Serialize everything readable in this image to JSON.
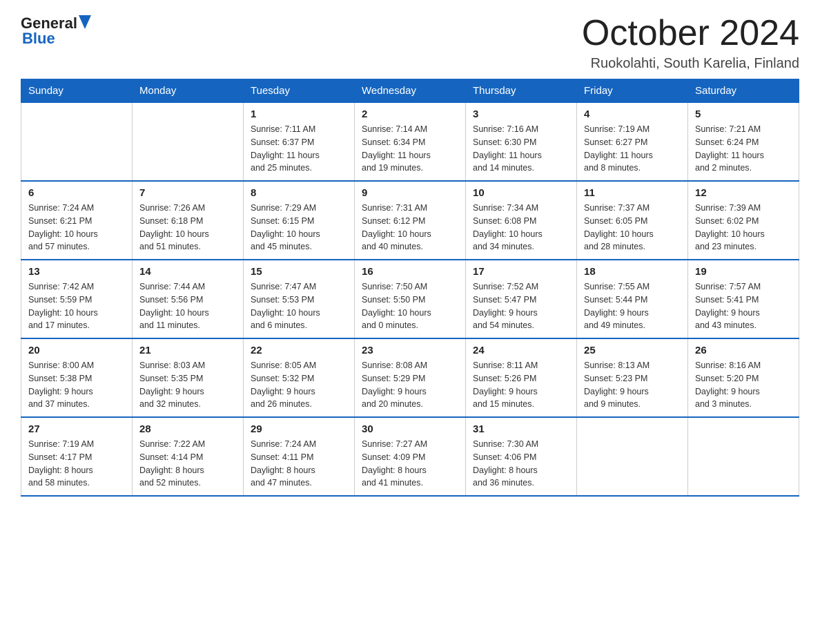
{
  "header": {
    "logo_general": "General",
    "logo_blue": "Blue",
    "title": "October 2024",
    "subtitle": "Ruokolahti, South Karelia, Finland"
  },
  "calendar": {
    "days_of_week": [
      "Sunday",
      "Monday",
      "Tuesday",
      "Wednesday",
      "Thursday",
      "Friday",
      "Saturday"
    ],
    "weeks": [
      [
        {
          "day": "",
          "info": ""
        },
        {
          "day": "",
          "info": ""
        },
        {
          "day": "1",
          "info": "Sunrise: 7:11 AM\nSunset: 6:37 PM\nDaylight: 11 hours\nand 25 minutes."
        },
        {
          "day": "2",
          "info": "Sunrise: 7:14 AM\nSunset: 6:34 PM\nDaylight: 11 hours\nand 19 minutes."
        },
        {
          "day": "3",
          "info": "Sunrise: 7:16 AM\nSunset: 6:30 PM\nDaylight: 11 hours\nand 14 minutes."
        },
        {
          "day": "4",
          "info": "Sunrise: 7:19 AM\nSunset: 6:27 PM\nDaylight: 11 hours\nand 8 minutes."
        },
        {
          "day": "5",
          "info": "Sunrise: 7:21 AM\nSunset: 6:24 PM\nDaylight: 11 hours\nand 2 minutes."
        }
      ],
      [
        {
          "day": "6",
          "info": "Sunrise: 7:24 AM\nSunset: 6:21 PM\nDaylight: 10 hours\nand 57 minutes."
        },
        {
          "day": "7",
          "info": "Sunrise: 7:26 AM\nSunset: 6:18 PM\nDaylight: 10 hours\nand 51 minutes."
        },
        {
          "day": "8",
          "info": "Sunrise: 7:29 AM\nSunset: 6:15 PM\nDaylight: 10 hours\nand 45 minutes."
        },
        {
          "day": "9",
          "info": "Sunrise: 7:31 AM\nSunset: 6:12 PM\nDaylight: 10 hours\nand 40 minutes."
        },
        {
          "day": "10",
          "info": "Sunrise: 7:34 AM\nSunset: 6:08 PM\nDaylight: 10 hours\nand 34 minutes."
        },
        {
          "day": "11",
          "info": "Sunrise: 7:37 AM\nSunset: 6:05 PM\nDaylight: 10 hours\nand 28 minutes."
        },
        {
          "day": "12",
          "info": "Sunrise: 7:39 AM\nSunset: 6:02 PM\nDaylight: 10 hours\nand 23 minutes."
        }
      ],
      [
        {
          "day": "13",
          "info": "Sunrise: 7:42 AM\nSunset: 5:59 PM\nDaylight: 10 hours\nand 17 minutes."
        },
        {
          "day": "14",
          "info": "Sunrise: 7:44 AM\nSunset: 5:56 PM\nDaylight: 10 hours\nand 11 minutes."
        },
        {
          "day": "15",
          "info": "Sunrise: 7:47 AM\nSunset: 5:53 PM\nDaylight: 10 hours\nand 6 minutes."
        },
        {
          "day": "16",
          "info": "Sunrise: 7:50 AM\nSunset: 5:50 PM\nDaylight: 10 hours\nand 0 minutes."
        },
        {
          "day": "17",
          "info": "Sunrise: 7:52 AM\nSunset: 5:47 PM\nDaylight: 9 hours\nand 54 minutes."
        },
        {
          "day": "18",
          "info": "Sunrise: 7:55 AM\nSunset: 5:44 PM\nDaylight: 9 hours\nand 49 minutes."
        },
        {
          "day": "19",
          "info": "Sunrise: 7:57 AM\nSunset: 5:41 PM\nDaylight: 9 hours\nand 43 minutes."
        }
      ],
      [
        {
          "day": "20",
          "info": "Sunrise: 8:00 AM\nSunset: 5:38 PM\nDaylight: 9 hours\nand 37 minutes."
        },
        {
          "day": "21",
          "info": "Sunrise: 8:03 AM\nSunset: 5:35 PM\nDaylight: 9 hours\nand 32 minutes."
        },
        {
          "day": "22",
          "info": "Sunrise: 8:05 AM\nSunset: 5:32 PM\nDaylight: 9 hours\nand 26 minutes."
        },
        {
          "day": "23",
          "info": "Sunrise: 8:08 AM\nSunset: 5:29 PM\nDaylight: 9 hours\nand 20 minutes."
        },
        {
          "day": "24",
          "info": "Sunrise: 8:11 AM\nSunset: 5:26 PM\nDaylight: 9 hours\nand 15 minutes."
        },
        {
          "day": "25",
          "info": "Sunrise: 8:13 AM\nSunset: 5:23 PM\nDaylight: 9 hours\nand 9 minutes."
        },
        {
          "day": "26",
          "info": "Sunrise: 8:16 AM\nSunset: 5:20 PM\nDaylight: 9 hours\nand 3 minutes."
        }
      ],
      [
        {
          "day": "27",
          "info": "Sunrise: 7:19 AM\nSunset: 4:17 PM\nDaylight: 8 hours\nand 58 minutes."
        },
        {
          "day": "28",
          "info": "Sunrise: 7:22 AM\nSunset: 4:14 PM\nDaylight: 8 hours\nand 52 minutes."
        },
        {
          "day": "29",
          "info": "Sunrise: 7:24 AM\nSunset: 4:11 PM\nDaylight: 8 hours\nand 47 minutes."
        },
        {
          "day": "30",
          "info": "Sunrise: 7:27 AM\nSunset: 4:09 PM\nDaylight: 8 hours\nand 41 minutes."
        },
        {
          "day": "31",
          "info": "Sunrise: 7:30 AM\nSunset: 4:06 PM\nDaylight: 8 hours\nand 36 minutes."
        },
        {
          "day": "",
          "info": ""
        },
        {
          "day": "",
          "info": ""
        }
      ]
    ]
  }
}
